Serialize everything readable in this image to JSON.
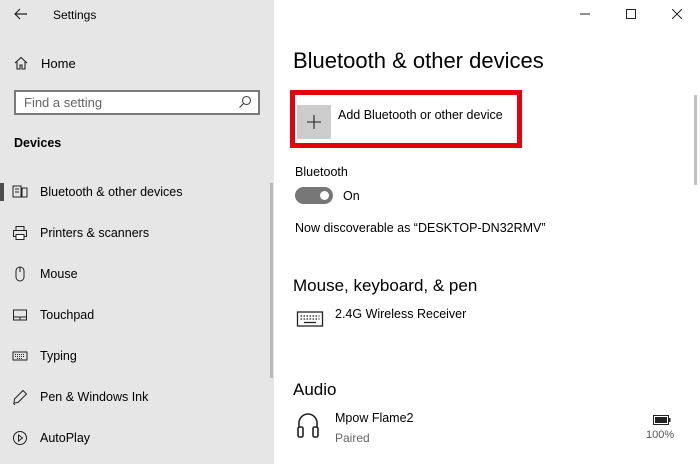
{
  "window": {
    "title": "Settings",
    "controls": {
      "minimize": "minimize-icon",
      "maximize": "maximize-icon",
      "close": "close-icon"
    }
  },
  "sidebar": {
    "home_label": "Home",
    "search": {
      "placeholder": "Find a setting",
      "value": ""
    },
    "section_label": "Devices",
    "items": [
      {
        "label": "Bluetooth & other devices",
        "icon": "bluetooth-devices-icon",
        "active": true
      },
      {
        "label": "Printers & scanners",
        "icon": "printer-icon",
        "active": false
      },
      {
        "label": "Mouse",
        "icon": "mouse-icon",
        "active": false
      },
      {
        "label": "Touchpad",
        "icon": "touchpad-icon",
        "active": false
      },
      {
        "label": "Typing",
        "icon": "keyboard-icon",
        "active": false
      },
      {
        "label": "Pen & Windows Ink",
        "icon": "pen-icon",
        "active": false
      },
      {
        "label": "AutoPlay",
        "icon": "autoplay-icon",
        "active": false
      }
    ]
  },
  "main": {
    "title": "Bluetooth & other devices",
    "add_device_label": "Add Bluetooth or other device",
    "bluetooth": {
      "label": "Bluetooth",
      "state": "On",
      "discoverable_text": "Now discoverable as “DESKTOP-DN32RMV”"
    },
    "mouse_section": {
      "heading": "Mouse, keyboard, & pen",
      "devices": [
        {
          "name": "2.4G Wireless Receiver",
          "icon": "keyboard-icon"
        }
      ]
    },
    "audio_section": {
      "heading": "Audio",
      "devices": [
        {
          "name": "Mpow Flame2",
          "status": "Paired",
          "icon": "headphones-icon",
          "battery": "100%"
        }
      ]
    }
  },
  "colors": {
    "highlight_border": "#e3000f",
    "sidebar_bg": "#e6e6e6",
    "toggle_on": "#777777"
  }
}
